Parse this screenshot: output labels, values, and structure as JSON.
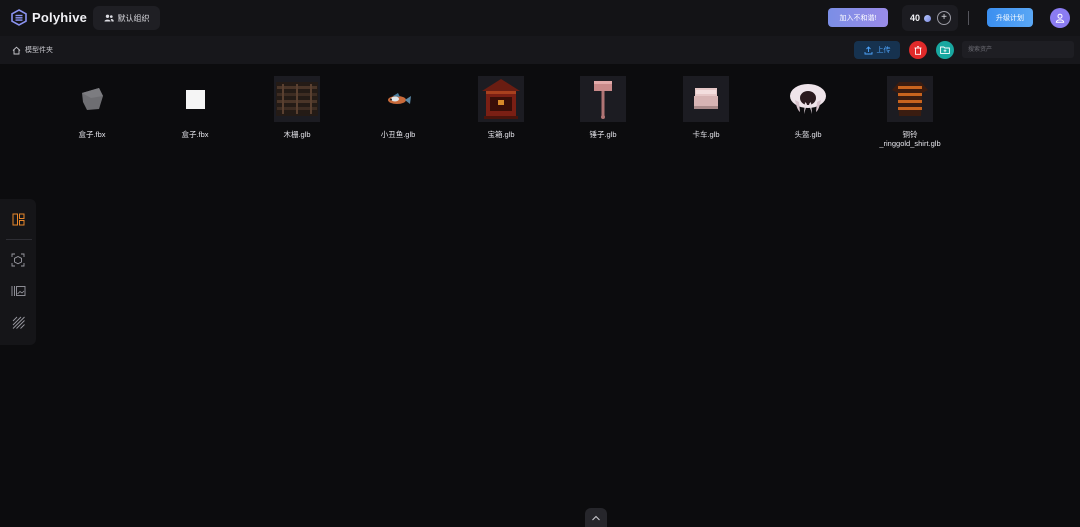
{
  "app": {
    "name": "Polyhive"
  },
  "header": {
    "org_label": "默认组织",
    "join_label": "加入不和谐!",
    "credits": "40",
    "upgrade_label": "升级计划"
  },
  "breadcrumb": {
    "label": "模型件夹"
  },
  "toolbar": {
    "upload_label": "上传",
    "search_placeholder": "搜索资产"
  },
  "assets": [
    {
      "label": "盒子.fbx"
    },
    {
      "label": "盒子.fbx"
    },
    {
      "label": "木栅.glb"
    },
    {
      "label": "小丑鱼.glb"
    },
    {
      "label": "宝箱.glb"
    },
    {
      "label": "锤子.glb"
    },
    {
      "label": "卡车.glb"
    },
    {
      "label": "头盔.glb"
    },
    {
      "label": "铜铃",
      "label2": "_ringgold_shirt.glb"
    }
  ],
  "colors": {
    "background": "#0c0c0e",
    "accent_blue": "#3b8ff0",
    "accent_purple": "#8b7cf2",
    "danger": "#e02a2a",
    "teal": "#18a7a0",
    "orange_icon": "#e8862a"
  },
  "icons": {
    "logo": "polyhive-hex-logo",
    "org": "users-icon",
    "home": "home-icon",
    "upload": "upload-icon",
    "delete": "trash-icon",
    "folder": "folder-add-icon",
    "avatar": "user-icon",
    "collapse": "chevron-up-icon"
  }
}
